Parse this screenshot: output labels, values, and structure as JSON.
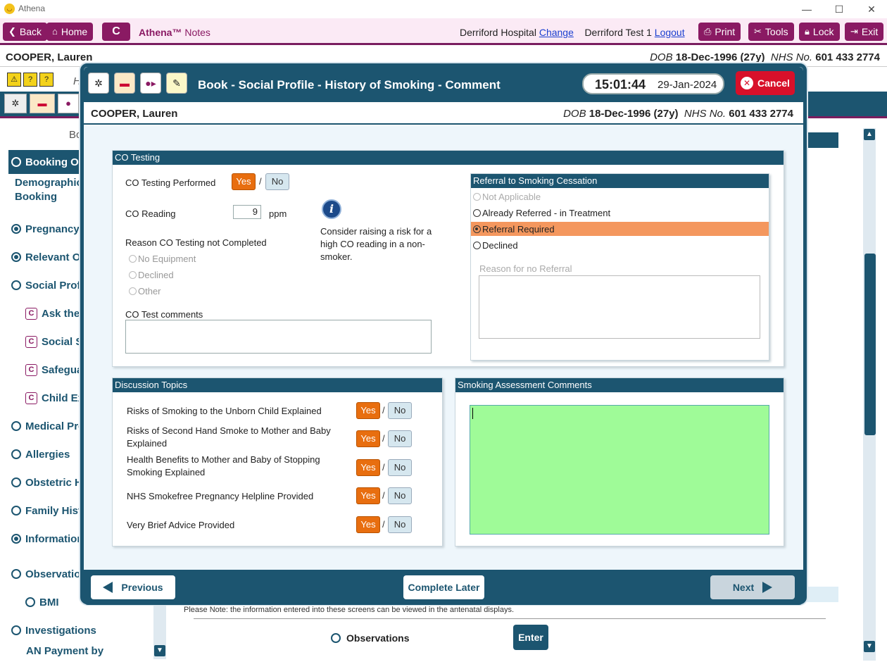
{
  "window": {
    "app_name": "Athena",
    "minimize": "—",
    "maximize": "☐",
    "close": "✕"
  },
  "toolbar": {
    "back": "Back",
    "home": "Home",
    "c_button": "C",
    "brand": "Athena™",
    "brand_suffix": "Notes",
    "hospital": "Derriford Hospital",
    "change": "Change",
    "user": "Derriford Test 1",
    "logout": "Logout",
    "print": "Print",
    "tools": "Tools",
    "lock": "Lock",
    "exit": "Exit"
  },
  "patient": {
    "name": "COOPER, Lauren",
    "dob_label": "DOB",
    "dob": "18-Dec-1996 (27y)",
    "nhs_label": "NHS No.",
    "nhs": "601 433 2774"
  },
  "background": {
    "heading_partial": "Bo",
    "h_partial": "H",
    "nav": [
      {
        "label": "Booking Ov",
        "type": "radio-empty"
      },
      {
        "label": "Demographics Booking",
        "type": "none"
      },
      {
        "label": "Pregnancy I",
        "type": "radio-filled"
      },
      {
        "label": "Relevant Ot",
        "type": "radio-filled"
      },
      {
        "label": "Social Profil",
        "type": "radio-empty"
      },
      {
        "label": "Ask the",
        "type": "c"
      },
      {
        "label": "Social Se",
        "type": "c"
      },
      {
        "label": "Safegua",
        "type": "c"
      },
      {
        "label": "Child Ex",
        "type": "c"
      },
      {
        "label": "Medical Pro",
        "type": "radio-empty"
      },
      {
        "label": "Allergies",
        "type": "radio-empty"
      },
      {
        "label": "Obstetric H",
        "type": "radio-empty"
      },
      {
        "label": "Family Histo",
        "type": "radio-empty"
      },
      {
        "label": "Information",
        "type": "radio-filled"
      },
      {
        "label": "Observation",
        "type": "radio-empty"
      },
      {
        "label": "BMI",
        "type": "radio-empty"
      },
      {
        "label": "Investigations",
        "type": "radio-empty"
      },
      {
        "label": "AN Payment by",
        "type": "none"
      }
    ],
    "note": "Please Note: the information entered into these screens can be viewed in the antenatal displays.",
    "observations": "Observations",
    "enter": "Enter"
  },
  "modal": {
    "title": "Book - Social Profile - History of Smoking - Comment",
    "time": "15:01:44",
    "date": "29-Jan-2024",
    "cancel": "Cancel",
    "co_testing": {
      "header": "CO Testing",
      "performed_label": "CO Testing Performed",
      "yes": "Yes",
      "slash": "/",
      "no": "No",
      "reading_label": "CO Reading",
      "reading_value": "9",
      "unit": "ppm",
      "info_text": "Consider raising a risk for a high CO reading in a non-smoker.",
      "reason_label": "Reason CO Testing not Completed",
      "reasons": [
        "No Equipment",
        "Declined",
        "Other"
      ],
      "comments_label": "CO Test comments"
    },
    "referral": {
      "header": "Referral to Smoking Cessation",
      "options": [
        {
          "label": "Not Applicable",
          "state": "disabled"
        },
        {
          "label": "Already Referred - in Treatment",
          "state": "normal"
        },
        {
          "label": "Referral Required",
          "state": "selected"
        },
        {
          "label": "Declined",
          "state": "normal"
        }
      ],
      "reason_label": "Reason for no Referral"
    },
    "discussion": {
      "header": "Discussion Topics",
      "topics": [
        {
          "label": "Risks of Smoking to the Unborn Child Explained",
          "yes": "Yes",
          "no": "No"
        },
        {
          "label": "Risks of Second Hand Smoke to Mother and Baby Explained",
          "yes": "Yes",
          "no": "No"
        },
        {
          "label": "Health Benefits to Mother and Baby of Stopping Smoking Explained",
          "yes": "Yes",
          "no": "No"
        },
        {
          "label": "NHS Smokefree Pregnancy Helpline Provided",
          "yes": "Yes",
          "no": "No"
        },
        {
          "label": "Very Brief Advice Provided",
          "yes": "Yes",
          "no": "No"
        }
      ]
    },
    "assessment": {
      "header": "Smoking Assessment Comments",
      "bg_color": "#9ffb98"
    },
    "footer": {
      "previous": "Previous",
      "complete_later": "Complete Later",
      "next": "Next"
    }
  },
  "colors": {
    "brand": "#8a1a63",
    "primary": "#1c5570",
    "yes": "#e86e0f",
    "cancel": "#d8102a"
  }
}
